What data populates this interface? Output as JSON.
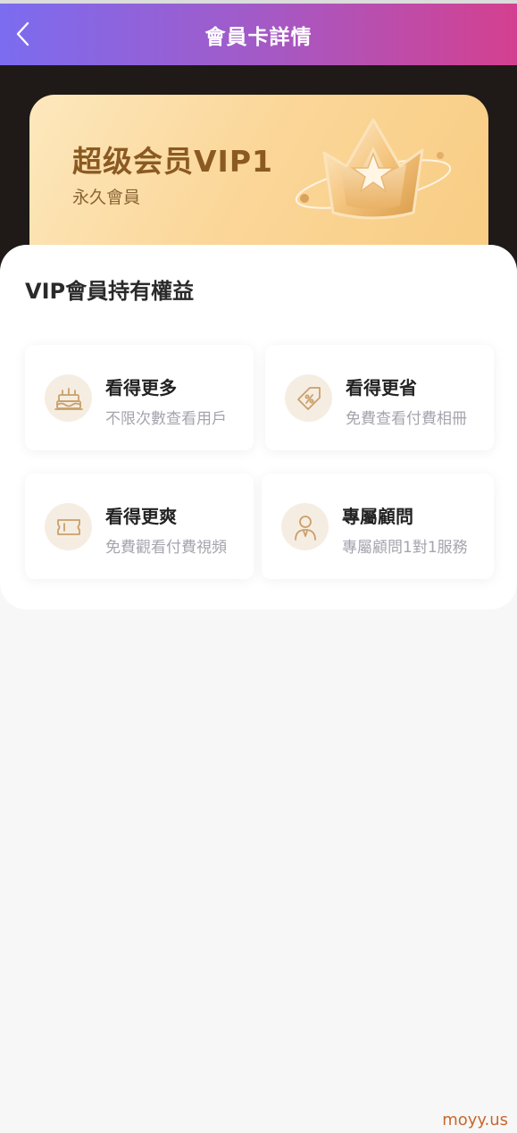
{
  "header": {
    "title": "會員卡詳情",
    "back_icon": "chevron-left-icon"
  },
  "vip_card": {
    "title": "超级会员VIP1",
    "subtitle": "永久會員",
    "emblem_icon": "crown-star-icon"
  },
  "benefits": {
    "heading": "VIP會員持有權益",
    "items": [
      {
        "title": "看得更多",
        "desc": "不限次數查看用戶",
        "icon": "cake-icon"
      },
      {
        "title": "看得更省",
        "desc": "免費查看付費相冊",
        "icon": "discount-tag-icon"
      },
      {
        "title": "看得更爽",
        "desc": "免費觀看付費視頻",
        "icon": "ticket-icon"
      },
      {
        "title": "專屬顧問",
        "desc": "專屬顧問1對1服務",
        "icon": "advisor-icon"
      }
    ]
  },
  "watermark": "moyy.us",
  "colors": {
    "header_gradient_start": "#7b6cf0",
    "header_gradient_end": "#d4408f",
    "card_gold": "#fbd79a",
    "icon_gold": "#c9a06a"
  }
}
